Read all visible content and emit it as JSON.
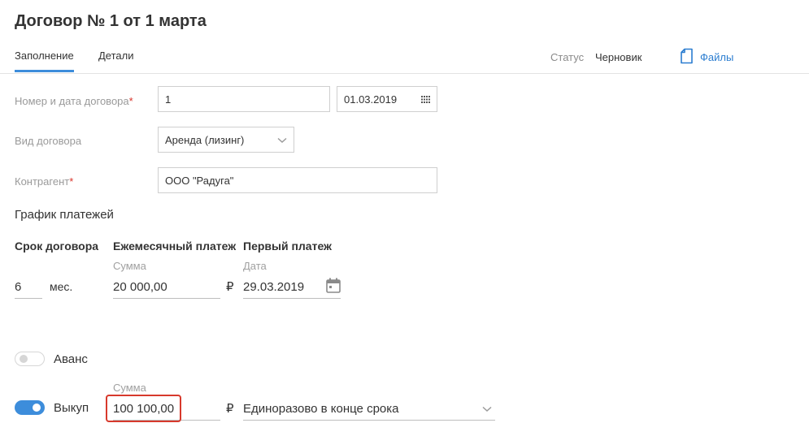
{
  "header": {
    "title": "Договор № 1 от 1 марта",
    "tabs": [
      {
        "label": "Заполнение",
        "active": true
      },
      {
        "label": "Детали",
        "active": false
      }
    ],
    "status_label": "Статус",
    "status_value": "Черновик",
    "files_label": "Файлы"
  },
  "form": {
    "number_date": {
      "label": "Номер и дата договора",
      "number": "1",
      "date": "01.03.2019"
    },
    "contract_type": {
      "label": "Вид договора",
      "value": "Аренда (лизинг)"
    },
    "counterparty": {
      "label": "Контрагент",
      "value": "ООО \"Радуга\""
    },
    "required_mark": "*"
  },
  "schedule": {
    "title": "График платежей",
    "term": {
      "heading": "Срок договора",
      "value": "6",
      "unit": "мес."
    },
    "monthly": {
      "heading": "Ежемесячный платеж",
      "sublabel": "Сумма",
      "value": "20 000,00",
      "currency": "₽"
    },
    "first": {
      "heading": "Первый платеж",
      "sublabel": "Дата",
      "value": "29.03.2019"
    }
  },
  "advance": {
    "label": "Аванс",
    "enabled": false
  },
  "buyout": {
    "label": "Выкуп",
    "enabled": true,
    "sublabel": "Сумма",
    "value": "100 100,00",
    "currency": "₽",
    "mode": "Единоразово в конце срока"
  },
  "colors": {
    "accent": "#3d8ddb",
    "link": "#2b7dd0",
    "required": "#d9342b",
    "highlight": "#d7392c"
  }
}
